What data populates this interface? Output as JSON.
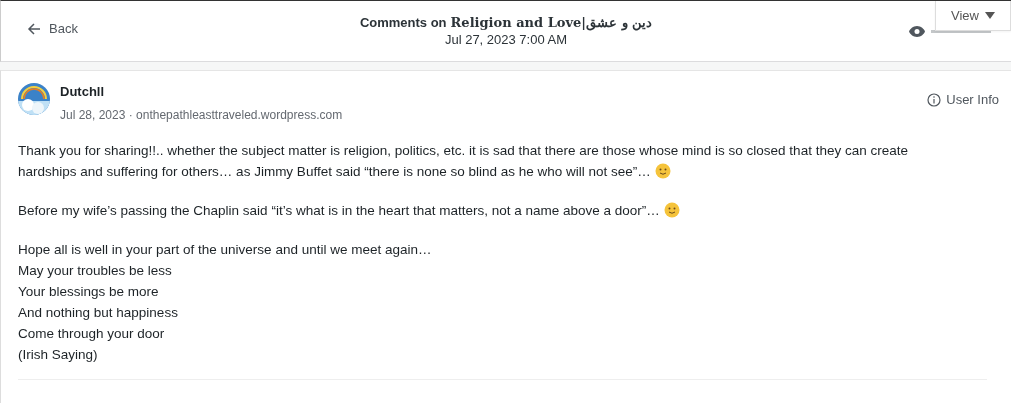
{
  "header": {
    "back": "Back",
    "title_prefix": "Comments on",
    "post_title": "Religion and Love|دین و عشق",
    "date": "Jul 27, 2023 7:00 AM",
    "view_menu": "View"
  },
  "comment": {
    "author": "Dutchll",
    "date": "Jul 28, 2023",
    "separator": "·",
    "site": "onthepathleasttraveled.wordpress.com",
    "user_info": "User Info",
    "paragraphs": [
      {
        "lines": [
          "Thank you for sharing!!.. whether the subject matter is religion, politics, etc. it is sad that there are those whose mind is so closed that they can create",
          "hardships and suffering for others… as Jimmy Buffet said “there is none so blind as he who will not see”…"
        ],
        "smiley": true
      },
      {
        "lines": [
          "Before my wife’s passing the Chaplin said “it’s what is in the heart that matters, not a name above a door”…"
        ],
        "smiley": true
      },
      {
        "lines": [
          "Hope all is well in your part of the universe and until we meet again…",
          "May your troubles be less",
          "Your blessings be more",
          "And nothing but happiness",
          "Come through your door",
          "(Irish Saying)"
        ],
        "smiley": false
      }
    ]
  }
}
